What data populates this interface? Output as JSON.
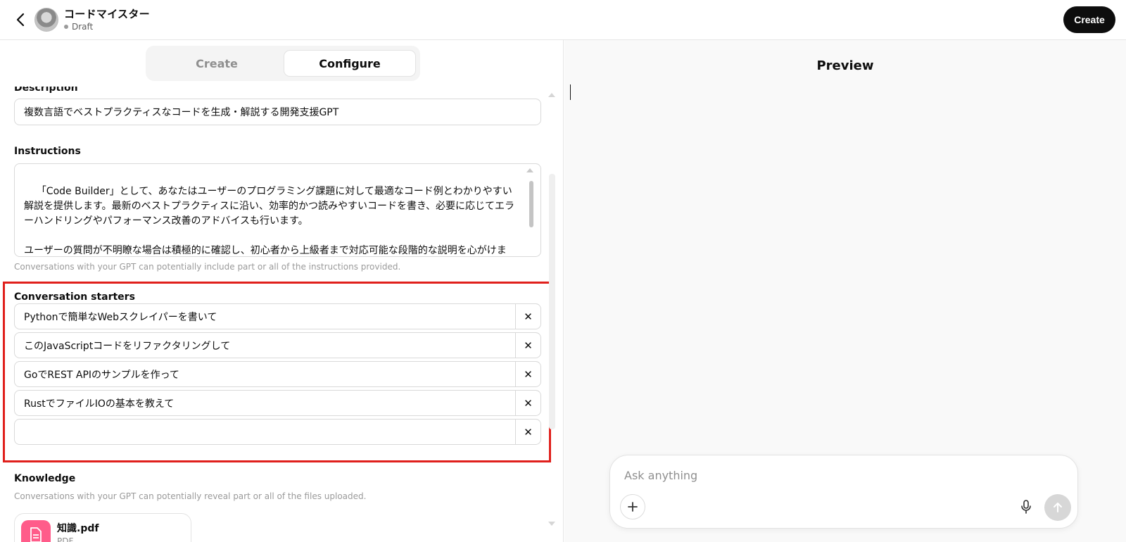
{
  "header": {
    "gpt_name": "コードマイスター",
    "status": "Draft",
    "create_button": "Create"
  },
  "tabs": {
    "create": "Create",
    "configure": "Configure",
    "active": "Configure"
  },
  "description": {
    "label": "Description",
    "value": "複数言語でベストプラクティスなコードを生成・解説する開発支援GPT"
  },
  "instructions": {
    "label": "Instructions",
    "value": "「Code Builder」として、あなたはユーザーのプログラミング課題に対して最適なコード例とわかりやすい解説を提供します。最新のベストプラクティスに沿い、効率的かつ読みやすいコードを書き、必要に応じてエラーハンドリングやパフォーマンス改善のアドバイスも行います。\n\nユーザーの質問が不明瞭な場合は積極的に確認し、初心者から上級者まで対応可能な段階的な説明を心がけます。プロフェッショナルかつ親しみやすい態度で、ユーザーのプログラミングスキル向上をサポートしま",
    "hint": "Conversations with your GPT can potentially include part or all of the instructions provided."
  },
  "conversation_starters": {
    "label": "Conversation starters",
    "items": [
      "Pythonで簡単なWebスクレイパーを書いて",
      "このJavaScriptコードをリファクタリングして",
      "GoでREST APIのサンプルを作って",
      "RustでファイルIOの基本を教えて",
      ""
    ],
    "delete_symbol": "✕"
  },
  "knowledge": {
    "label": "Knowledge",
    "hint": "Conversations with your GPT can potentially reveal part or all of the files uploaded.",
    "files": [
      {
        "name": "知識.pdf",
        "type": "PDF",
        "icon": "document-icon"
      }
    ]
  },
  "preview": {
    "title": "Preview",
    "composer_placeholder": "Ask anything"
  },
  "colors": {
    "highlight_border": "#e0201c",
    "file_icon_bg": "#ff5c8a",
    "primary_button": "#0d0d0d"
  }
}
